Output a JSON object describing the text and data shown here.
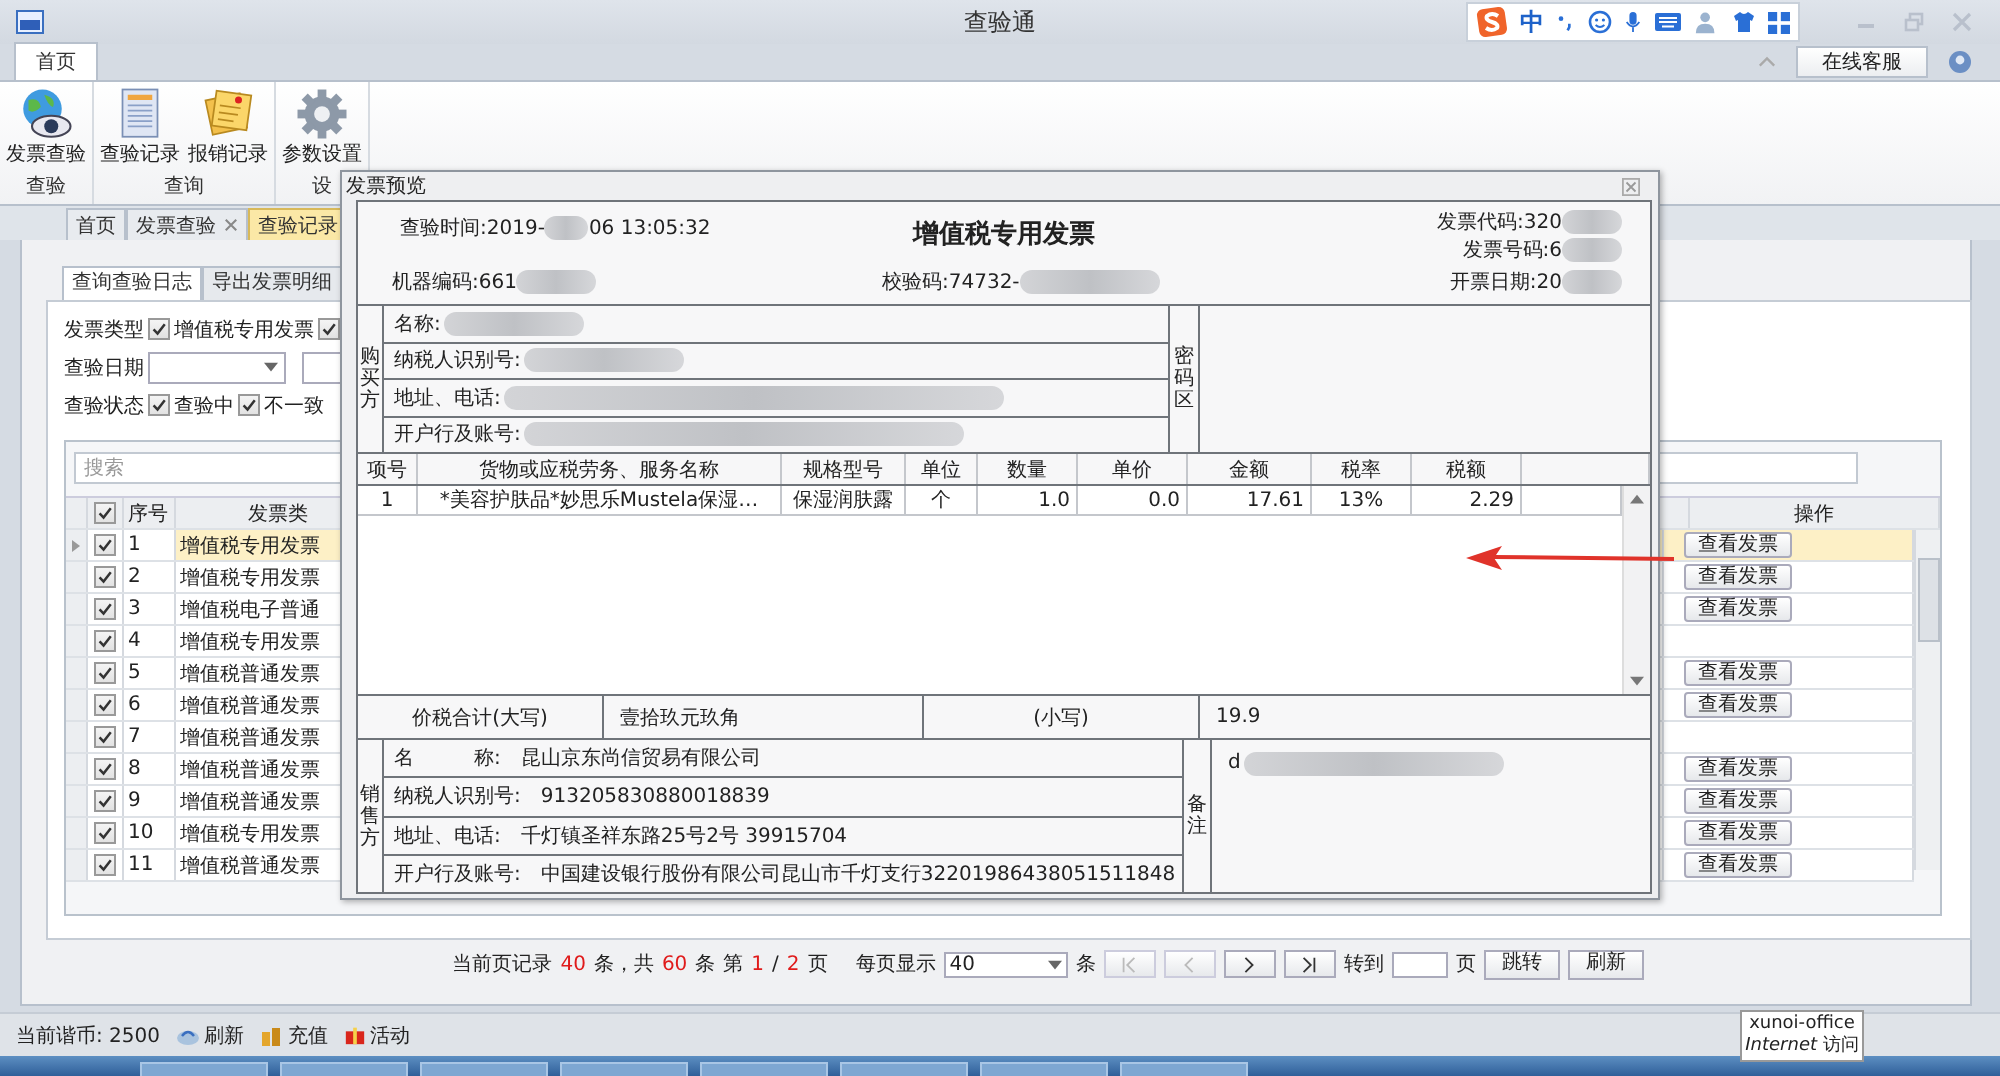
{
  "window": {
    "title": "查验通",
    "ime_mode": "中",
    "service_button": "在线客服"
  },
  "ribbon": {
    "tabs": [
      {
        "label": "首页",
        "selected": true
      }
    ],
    "groups": [
      {
        "label": "查验",
        "buttons": [
          {
            "label": "发票查验",
            "kind": "globe"
          }
        ]
      },
      {
        "label": "查询",
        "buttons": [
          {
            "label": "查验记录",
            "kind": "document"
          },
          {
            "label": "报销记录",
            "kind": "note"
          }
        ]
      },
      {
        "label": "设",
        "buttons": [
          {
            "label": "参数设置",
            "kind": "gear"
          }
        ]
      }
    ]
  },
  "doc_tabs": [
    {
      "label": "首页",
      "selected": false,
      "closable": false
    },
    {
      "label": "发票查验",
      "selected": false,
      "closable": true
    },
    {
      "label": "查验记录",
      "selected": true,
      "closable": false
    }
  ],
  "sub_tabs": [
    {
      "label": "查询查验日志",
      "selected": true
    },
    {
      "label": "导出发票明细",
      "selected": false
    }
  ],
  "filters": {
    "type_label": "发票类型",
    "type_options": [
      {
        "label": "增值税专用发票",
        "checked": true
      },
      {
        "checked": true
      }
    ],
    "date_label": "查验日期",
    "status_label": "查验状态",
    "status_options": [
      {
        "label": "查验中",
        "checked": true
      },
      {
        "label": "不一致",
        "checked": true
      }
    ]
  },
  "search": {
    "placeholder": "搜索"
  },
  "grid": {
    "all_checked": true,
    "columns": {
      "number": "序号",
      "type": "发票类",
      "action": "操作"
    },
    "rows": [
      {
        "selected": true,
        "checked": true,
        "number": "1",
        "type": "增值税专用发票",
        "action": "查看发票"
      },
      {
        "selected": false,
        "checked": true,
        "number": "2",
        "type": "增值税专用发票",
        "action": "查看发票"
      },
      {
        "selected": false,
        "checked": true,
        "number": "3",
        "type": "增值税电子普通",
        "action": "查看发票"
      },
      {
        "selected": false,
        "checked": true,
        "number": "4",
        "type": "增值税专用发票"
      },
      {
        "selected": false,
        "checked": true,
        "number": "5",
        "type": "增值税普通发票",
        "action": "查看发票"
      },
      {
        "selected": false,
        "checked": true,
        "number": "6",
        "type": "增值税普通发票",
        "action": "查看发票"
      },
      {
        "selected": false,
        "checked": true,
        "number": "7",
        "type": "增值税普通发票"
      },
      {
        "selected": false,
        "checked": true,
        "number": "8",
        "type": "增值税普通发票",
        "action": "查看发票"
      },
      {
        "selected": false,
        "checked": true,
        "number": "9",
        "type": "增值税普通发票",
        "action": "查看发票"
      },
      {
        "selected": false,
        "checked": true,
        "number": "10",
        "type": "增值税专用发票",
        "action": "查看发票"
      },
      {
        "selected": false,
        "checked": true,
        "number": "11",
        "type": "增值税普通发票",
        "action": "查看发票"
      }
    ]
  },
  "pager": {
    "info": [
      {
        "text": "当前页记录",
        "kind": "label"
      },
      {
        "text": "40",
        "kind": "number"
      },
      {
        "text": "条，共",
        "kind": "label"
      },
      {
        "text": "60",
        "kind": "number"
      },
      {
        "text": "条",
        "kind": "label"
      },
      {
        "text": "第",
        "kind": "label"
      },
      {
        "text": "1",
        "kind": "number"
      },
      {
        "text": "/",
        "kind": "label"
      },
      {
        "text": "2",
        "kind": "number"
      },
      {
        "text": "页",
        "kind": "label"
      }
    ],
    "per_page_label": "每页显示",
    "per_page": "40",
    "per_page_unit": "条",
    "nav": [
      {
        "kind": "first",
        "disabled": true
      },
      {
        "kind": "prev",
        "disabled": true
      },
      {
        "kind": "next",
        "disabled": false
      },
      {
        "kind": "last",
        "disabled": false
      }
    ],
    "goto_label": "转到",
    "goto_unit": "页",
    "jump_button": "跳转",
    "refresh_button": "刷新"
  },
  "status_bar": {
    "balance": "当前谐币: 2500",
    "actions": [
      {
        "label": "刷新",
        "kind": "refresh"
      },
      {
        "label": "充值",
        "kind": "recharge"
      },
      {
        "label": "活动",
        "kind": "gift"
      }
    ]
  },
  "tooltip": {
    "title": "xunoi-office",
    "subtitle": "*Internet* 访问"
  },
  "dialog": {
    "title": "发票预览",
    "invoice": {
      "title": "增值税专用发票",
      "check_time": "查验时间:2019-",
      "check_time_rest": "06 13:05:32",
      "code": "发票代码:320",
      "number": "发票号码:6",
      "machine": "机器编码:661",
      "check_code": "校验码:74732-",
      "date": "开票日期:20",
      "buyer_label": "购买方",
      "buyer_fields": [
        "名称:",
        "纳税人识别号:",
        "地址、电话:",
        "开户行及账号:"
      ],
      "cipher_label": "密码区",
      "item_columns": [
        "项号",
        "货物或应税劳务、服务名称",
        "规格型号",
        "单位",
        "数量",
        "单价",
        "金额",
        "税率",
        "税额"
      ],
      "item_rows": [
        [
          "1",
          "*美容护肤品*妙思乐Mustela保湿…",
          "保湿润肤露",
          "个",
          "1.0",
          "0.0",
          "17.61",
          "13%",
          "2.29"
        ]
      ],
      "total_label": "价税合计(大写)",
      "total_words": "壹拾玖元玖角",
      "small_label": "(小写)",
      "total_amount": "19.9",
      "seller_label": "销售方",
      "seller_fields": [
        {
          "label": "名　　　称:",
          "value": "昆山京东尚信贸易有限公司"
        },
        {
          "label": "纳税人识别号:",
          "value": "913205830880018839"
        },
        {
          "label": "地址、电话:",
          "value": "千灯镇圣祥东路25号2号 39915704"
        },
        {
          "label": "开户行及账号:",
          "value": "中国建设银行股份有限公司昆山市千灯支行32201986438051511848"
        }
      ],
      "remark_label": "备注",
      "remark": "d"
    }
  }
}
